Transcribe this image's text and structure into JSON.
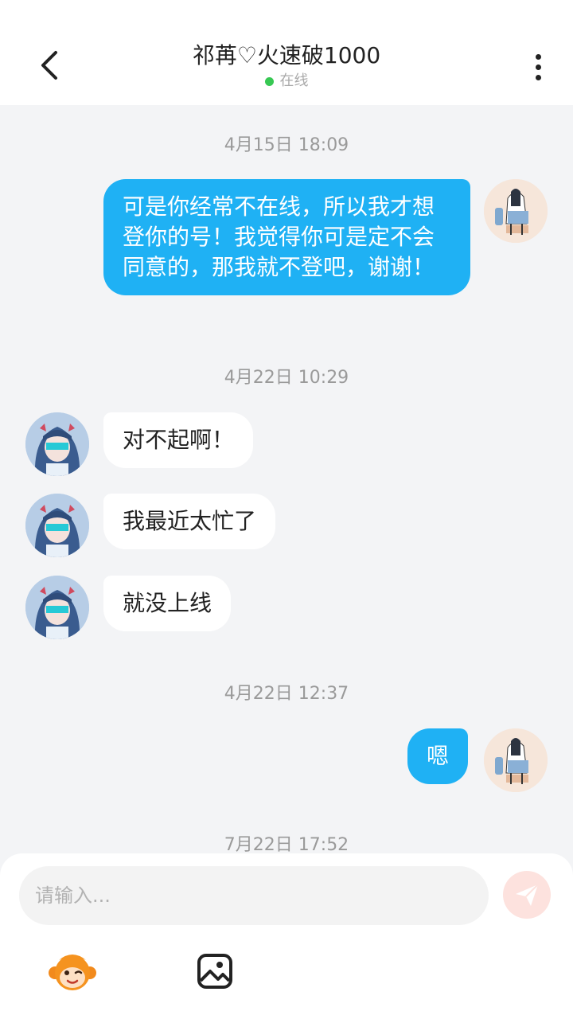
{
  "header": {
    "title": "祁苒♡火速破1000",
    "status": "在线"
  },
  "messages": [
    {
      "timestamp": "4月15日 18:09",
      "from": "me",
      "text": "可是你经常不在线，所以我才想登你的号！我觉得你可是定不会同意的，那我就不登吧，谢谢！"
    },
    {
      "timestamp": "4月22日 10:29",
      "from": "other",
      "text": "对不起啊！"
    },
    {
      "from": "other",
      "text": "我最近太忙了"
    },
    {
      "from": "other",
      "text": "就没上线"
    },
    {
      "timestamp": "4月22日 12:37",
      "from": "me",
      "text": "嗯"
    },
    {
      "timestamp": "7月22日 17:52"
    }
  ],
  "input": {
    "placeholder": "请输入..."
  },
  "icons": {
    "back": "chevron-left-icon",
    "more": "more-vertical-icon",
    "send": "paper-plane-icon",
    "emoji": "monkey-emoji-icon",
    "image": "image-icon"
  },
  "colors": {
    "my_bubble": "#1fb1f4",
    "their_bubble": "#ffffff",
    "online_dot": "#37c853",
    "send_button": "#fde2de"
  }
}
